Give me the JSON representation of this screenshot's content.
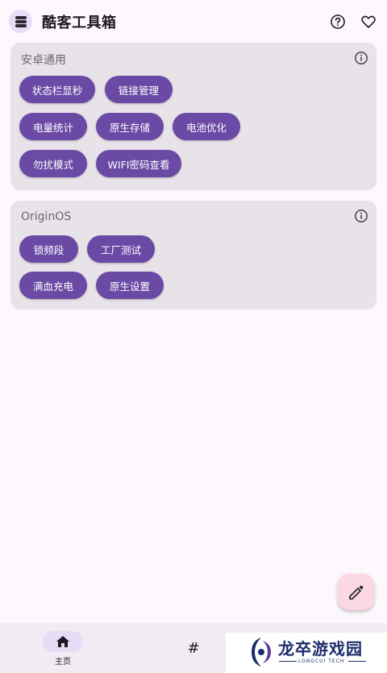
{
  "app": {
    "title": "酷客工具箱",
    "icons": [
      "layers-icon",
      "help-icon",
      "heart-icon"
    ]
  },
  "sections": [
    {
      "title": "安卓通用",
      "chips": [
        "状态栏显秒",
        "链接管理",
        "电量统计",
        "原生存储",
        "电池优化",
        "勿扰模式",
        "WIFI密码查看"
      ]
    },
    {
      "title": "OriginOS",
      "chips": [
        "锁频段",
        "工厂测试",
        "满血充电",
        "原生设置"
      ]
    }
  ],
  "fab": {
    "icon": "edit-pencil-icon"
  },
  "bottom_nav": {
    "home_label": "主页",
    "home_icon": "home-icon",
    "second_icon": "hash-icon",
    "second_glyph": "#"
  },
  "watermark": {
    "text": "龙卒游戏园",
    "sub": "LONGCUI TECH"
  },
  "colors": {
    "chip": "#6a4aa5",
    "card": "#e8e2e9",
    "background": "#fdf8fd",
    "fab": "#fcd8e2"
  }
}
